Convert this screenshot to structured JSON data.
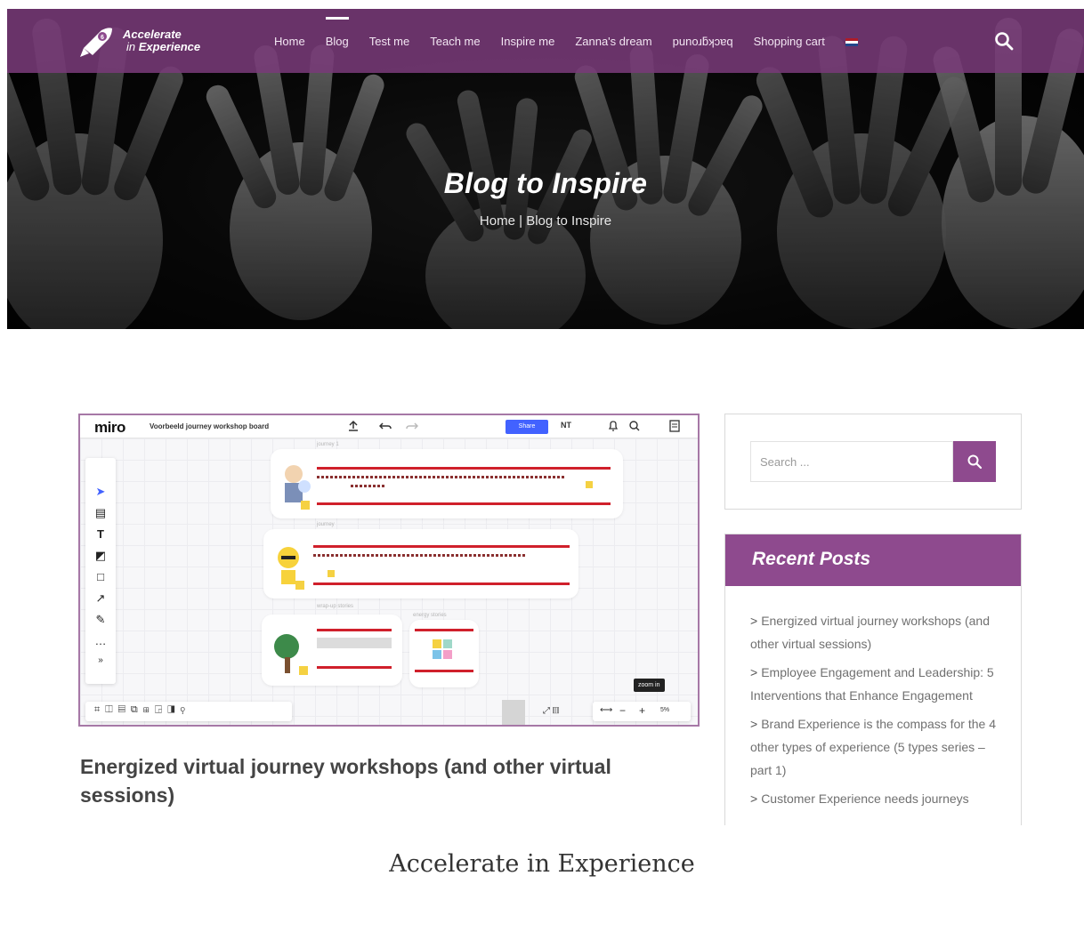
{
  "site": {
    "brand_line1": "Accelerate",
    "brand_line2a": "in",
    "brand_line2b": "Experience"
  },
  "nav": {
    "items": [
      {
        "label": "Home"
      },
      {
        "label": "Blog",
        "active": true
      },
      {
        "label": "Test me"
      },
      {
        "label": "Teach me"
      },
      {
        "label": "Inspire me"
      },
      {
        "label": "Zanna's dream"
      },
      {
        "label": "punoɹƃʞɔɐq"
      },
      {
        "label": "Shopping cart"
      }
    ],
    "language_flag": "flag-icon",
    "search_icon": "search-icon"
  },
  "hero": {
    "title": "Blog to Inspire",
    "breadcrumb_home": "Home",
    "breadcrumb_separator": "|",
    "breadcrumb_current": "Blog to Inspire"
  },
  "post": {
    "title": "Energized virtual journey workshops (and other virtual sessions)",
    "image": {
      "app": "miro",
      "board_name": "Voorbeeld journey workshop board",
      "share_label": "Share",
      "user_initials": "NT",
      "tooltip": "zoom in",
      "zoom_level": "5%",
      "frame_labels": [
        "journey 1",
        "journey",
        "wrap-up stories",
        "energy stories"
      ]
    }
  },
  "sidebar": {
    "search_placeholder": "Search ...",
    "recent_title": "Recent Posts",
    "recent_posts": [
      {
        "label": "Energized virtual journey workshops (and other virtual sessions)"
      },
      {
        "label": "Employee Engagement and Leadership: 5 Interventions that Enhance Engagement"
      },
      {
        "label": "Brand Experience is the compass for the 4 other types of experience (5 types series – part 1)"
      },
      {
        "label": "Customer Experience needs journeys"
      }
    ]
  },
  "caption": "Accelerate in Experience",
  "colors": {
    "nav_bg": "#783a78",
    "accent": "#8e4a8e",
    "post_border": "#a678a6"
  }
}
